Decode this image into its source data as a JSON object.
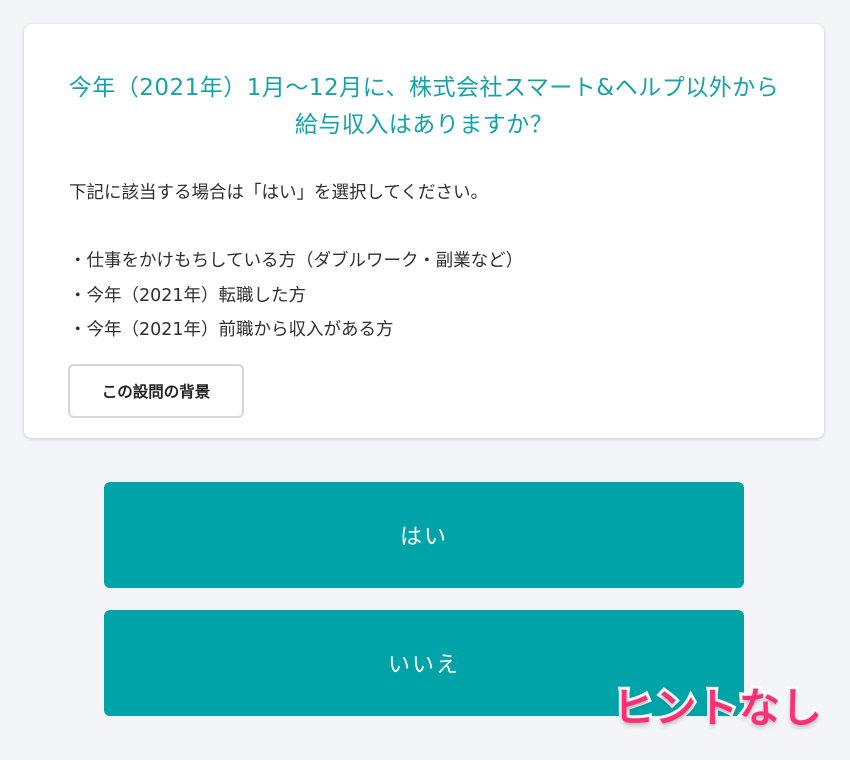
{
  "question": {
    "title": "今年（2021年）1月〜12月に、株式会社スマート&ヘルプ以外から給与収入はありますか？",
    "description": "下記に該当する場合は「はい」を選択してください。",
    "bullets": [
      "・仕事をかけもちしている方（ダブルワーク・副業など）",
      "・今年（2021年）転職した方",
      "・今年（2021年）前職から収入がある方"
    ],
    "background_button_label": "この設問の背景"
  },
  "answers": {
    "yes_label": "はい",
    "no_label": "いいえ"
  },
  "overlay": {
    "hint_text": "ヒントなし"
  },
  "colors": {
    "accent": "#00a3a8",
    "title_text": "#13a3a8",
    "page_background": "#f4f5f9",
    "hint_text": "#ff2d75"
  }
}
